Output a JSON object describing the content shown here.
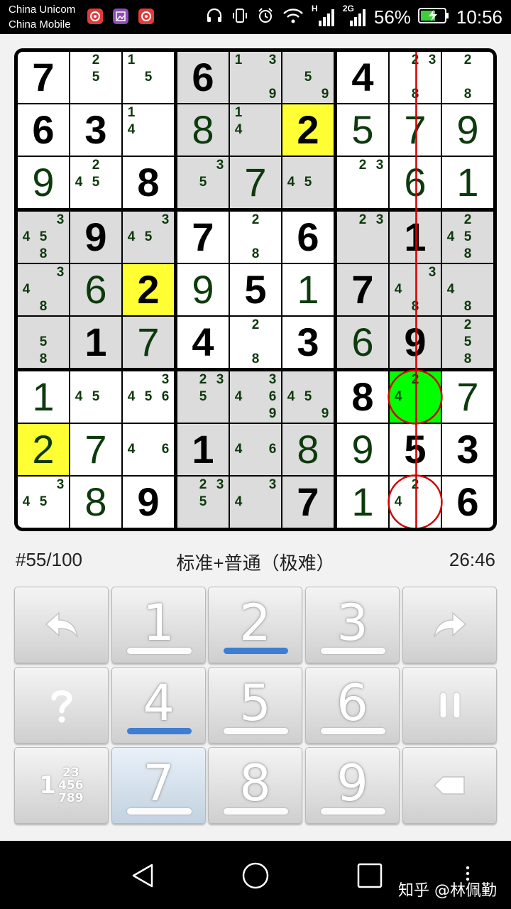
{
  "status_bar": {
    "carrier1": "China Unicom",
    "carrier2": "China Mobile",
    "notification_icons": [
      "netease-music-icon",
      "gallery-icon",
      "netease-music-icon"
    ],
    "network_h": "H",
    "network_2g": "2G",
    "battery": "56%",
    "time": "10:56"
  },
  "board": {
    "cells": [
      [
        {
          "v": "7",
          "g": true
        },
        {
          "c": [
            2,
            5
          ]
        },
        {
          "c": [
            1,
            5
          ]
        },
        {
          "v": "6",
          "g": true
        },
        {
          "c": [
            1,
            3,
            9
          ]
        },
        {
          "c": [
            5,
            9
          ]
        },
        {
          "v": "4",
          "g": true
        },
        {
          "c": [
            2,
            3,
            8
          ]
        },
        {
          "c": [
            2,
            8
          ]
        }
      ],
      [
        {
          "v": "6",
          "g": true
        },
        {
          "v": "3",
          "g": true
        },
        {
          "c": [
            1,
            4
          ]
        },
        {
          "v": "8"
        },
        {
          "c": [
            1,
            4
          ]
        },
        {
          "v": "2",
          "g": true
        },
        {
          "v": "5"
        },
        {
          "v": "7"
        },
        {
          "v": "9"
        }
      ],
      [
        {
          "v": "9"
        },
        {
          "c": [
            2,
            4,
            5
          ]
        },
        {
          "v": "8",
          "g": true
        },
        {
          "c": [
            3,
            5
          ]
        },
        {
          "v": "7"
        },
        {
          "c": [
            4,
            5
          ]
        },
        {
          "c": [
            2,
            3
          ]
        },
        {
          "v": "6"
        },
        {
          "v": "1"
        }
      ],
      [
        {
          "c": [
            3,
            4,
            5,
            8
          ]
        },
        {
          "v": "9",
          "g": true
        },
        {
          "c": [
            3,
            4,
            5
          ]
        },
        {
          "v": "7",
          "g": true
        },
        {
          "c": [
            2,
            8
          ]
        },
        {
          "v": "6",
          "g": true
        },
        {
          "c": [
            2,
            3
          ]
        },
        {
          "v": "1",
          "g": true
        },
        {
          "c": [
            2,
            4,
            5,
            8
          ]
        }
      ],
      [
        {
          "c": [
            3,
            4,
            8
          ]
        },
        {
          "v": "6"
        },
        {
          "v": "2",
          "g": true
        },
        {
          "v": "9"
        },
        {
          "v": "5",
          "g": true
        },
        {
          "v": "1"
        },
        {
          "v": "7",
          "g": true
        },
        {
          "c": [
            3,
            4,
            8
          ]
        },
        {
          "c": [
            4,
            8
          ]
        }
      ],
      [
        {
          "c": [
            5,
            8
          ]
        },
        {
          "v": "1",
          "g": true
        },
        {
          "v": "7"
        },
        {
          "v": "4",
          "g": true
        },
        {
          "c": [
            2,
            8
          ]
        },
        {
          "v": "3",
          "g": true
        },
        {
          "v": "6"
        },
        {
          "v": "9",
          "g": true
        },
        {
          "c": [
            2,
            5,
            8
          ]
        }
      ],
      [
        {
          "v": "1"
        },
        {
          "c": [
            4,
            5
          ]
        },
        {
          "c": [
            3,
            4,
            5,
            6
          ]
        },
        {
          "c": [
            2,
            3,
            5
          ]
        },
        {
          "c": [
            3,
            4,
            6,
            9
          ]
        },
        {
          "c": [
            4,
            5,
            9
          ]
        },
        {
          "v": "8",
          "g": true
        },
        {
          "c": [
            2,
            4
          ]
        },
        {
          "v": "7"
        }
      ],
      [
        {
          "v": "2"
        },
        {
          "v": "7"
        },
        {
          "c": [
            4,
            6
          ]
        },
        {
          "v": "1",
          "g": true
        },
        {
          "c": [
            4,
            6
          ]
        },
        {
          "v": "8"
        },
        {
          "v": "9"
        },
        {
          "v": "5",
          "g": true
        },
        {
          "v": "3",
          "g": true
        }
      ],
      [
        {
          "c": [
            3,
            4,
            5
          ]
        },
        {
          "v": "8"
        },
        {
          "v": "9",
          "g": true
        },
        {
          "c": [
            2,
            3,
            5
          ]
        },
        {
          "c": [
            3,
            4
          ]
        },
        {
          "v": "7",
          "g": true
        },
        {
          "v": "1"
        },
        {
          "c": [
            2,
            4
          ]
        },
        {
          "v": "6",
          "g": true
        }
      ]
    ],
    "highlighted_yellow": [
      [
        1,
        5
      ],
      [
        4,
        2
      ],
      [
        7,
        0
      ]
    ],
    "selected_green": [
      6,
      7
    ],
    "circled_cells": [
      [
        6,
        7
      ],
      [
        8,
        7
      ]
    ],
    "red_line_column": 7,
    "colors": {
      "shaded_box": "#dcdcdc",
      "white_box": "#ffffff",
      "yellow": "#ffff33",
      "green": "#00ff00",
      "annotation_red": "#d40000",
      "candidate": "#0c3a0c"
    }
  },
  "info": {
    "puzzle_number": "#55/100",
    "puzzle_type": "标准+普通（极难）",
    "timer": "26:46"
  },
  "keypad": {
    "keys": [
      {
        "id": "undo",
        "icon": "undo-icon"
      },
      {
        "id": "1",
        "label": "1",
        "active": false
      },
      {
        "id": "2",
        "label": "2",
        "active": true
      },
      {
        "id": "3",
        "label": "3",
        "active": false
      },
      {
        "id": "redo",
        "icon": "redo-icon"
      },
      {
        "id": "hint",
        "icon": "question-icon"
      },
      {
        "id": "4",
        "label": "4",
        "active": true
      },
      {
        "id": "5",
        "label": "5",
        "active": false
      },
      {
        "id": "6",
        "label": "6",
        "active": false
      },
      {
        "id": "pause",
        "icon": "pause-icon"
      },
      {
        "id": "pencil",
        "icon": "candidate-mode-icon",
        "icon_text": [
          "1",
          "23",
          "456",
          "789"
        ]
      },
      {
        "id": "7",
        "label": "7",
        "active": false,
        "selected": true
      },
      {
        "id": "8",
        "label": "8",
        "active": false
      },
      {
        "id": "9",
        "label": "9",
        "active": false
      },
      {
        "id": "erase",
        "icon": "erase-icon"
      }
    ]
  },
  "nav_bar": {
    "buttons": [
      "back-icon",
      "home-icon",
      "recents-icon"
    ],
    "watermark": "知乎 @林佩勤"
  }
}
